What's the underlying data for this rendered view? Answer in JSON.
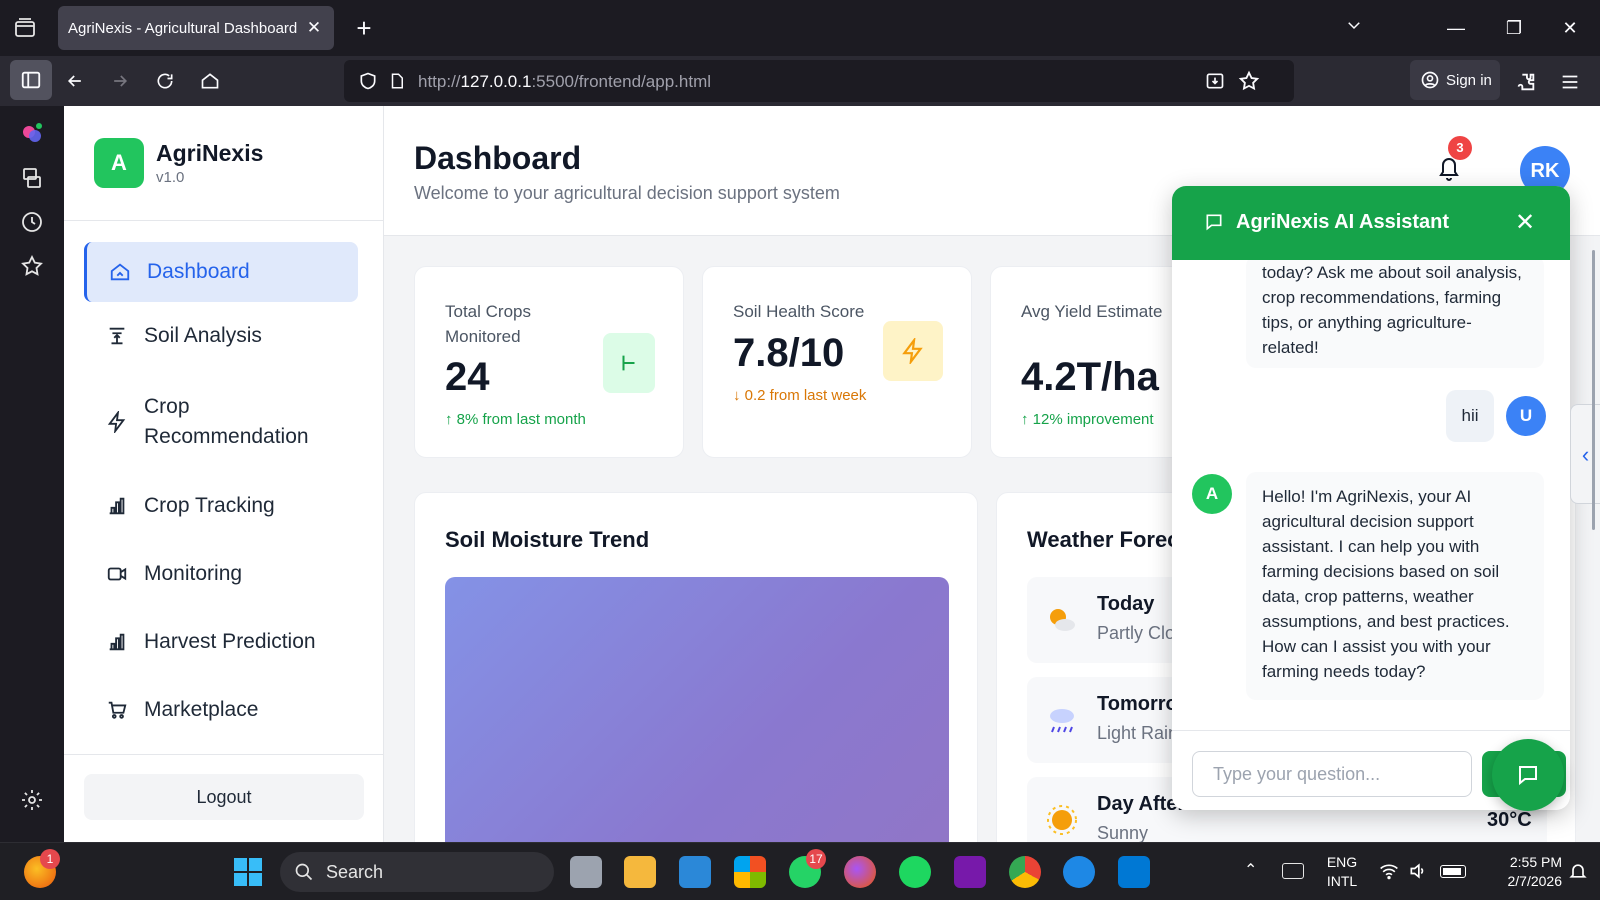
{
  "browser": {
    "tab_title": "AgriNexis - Agricultural Dashboard",
    "url_prefix": "http://",
    "url_host": "127.0.0.1",
    "url_rest": ":5500/frontend/app.html",
    "sign_in": "Sign in"
  },
  "sidebar": {
    "brand_letter": "A",
    "brand_name": "AgriNexis",
    "version": "v1.0",
    "items": [
      {
        "label": "Dashboard",
        "icon": "home-icon",
        "active": true
      },
      {
        "label": "Soil Analysis",
        "icon": "soil-icon"
      },
      {
        "label": "Crop Recommendation",
        "icon": "bolt-icon"
      },
      {
        "label": "Crop Tracking",
        "icon": "bar-chart-icon"
      },
      {
        "label": "Monitoring",
        "icon": "video-icon"
      },
      {
        "label": "Harvest Prediction",
        "icon": "bar-chart-icon"
      },
      {
        "label": "Marketplace",
        "icon": "cart-icon"
      }
    ],
    "logout": "Logout"
  },
  "header": {
    "title": "Dashboard",
    "subtitle": "Welcome to your agricultural decision support system",
    "notification_count": "3",
    "avatar_initials": "RK"
  },
  "stats": [
    {
      "label": "Total Crops Monitored",
      "value": "24",
      "delta": "↑ 8% from last month",
      "delta_color": "#16a34a"
    },
    {
      "label": "Soil Health Score",
      "value": "7.8/10",
      "delta": "↓ 0.2 from last week",
      "delta_color": "#d97706"
    },
    {
      "label": "Avg Yield Estimate",
      "value": "4.2T/ha",
      "delta": "↑ 12% improvement",
      "delta_color": "#16a34a"
    }
  ],
  "soil_chart": {
    "title": "Soil Moisture Trend"
  },
  "weather": {
    "title": "Weather Forecast",
    "days": [
      {
        "day": "Today",
        "desc": "Partly Cloudy",
        "icon": "partly-cloudy-icon"
      },
      {
        "day": "Tomorrow",
        "desc": "Light Rain",
        "icon": "rain-cloud-icon"
      },
      {
        "day": "Day After",
        "desc": "Sunny",
        "icon": "sun-icon",
        "temp": "30°C"
      }
    ]
  },
  "chat": {
    "title": "AgriNexis AI Assistant",
    "msg1": "today? Ask me about soil analysis, crop recommendations, farming tips, or anything agriculture-related!",
    "user_msg": "hii",
    "user_initial": "U",
    "bot_initial": "A",
    "msg2": "Hello! I'm AgriNexis, your AI agricultural decision support assistant. I can help you with farming decisions based on soil data, crop patterns, weather assumptions, and best practices. How can I assist you with your farming needs today?",
    "placeholder": "Type your question..."
  },
  "taskbar": {
    "search": "Search",
    "lang": "ENG",
    "layout": "INTL",
    "time": "2:55 PM",
    "date": "2/7/2026",
    "firefox_badge": "1",
    "whatsapp_badge": "17"
  },
  "colors": {
    "accent": "#16a34a",
    "primary": "#2563eb"
  }
}
